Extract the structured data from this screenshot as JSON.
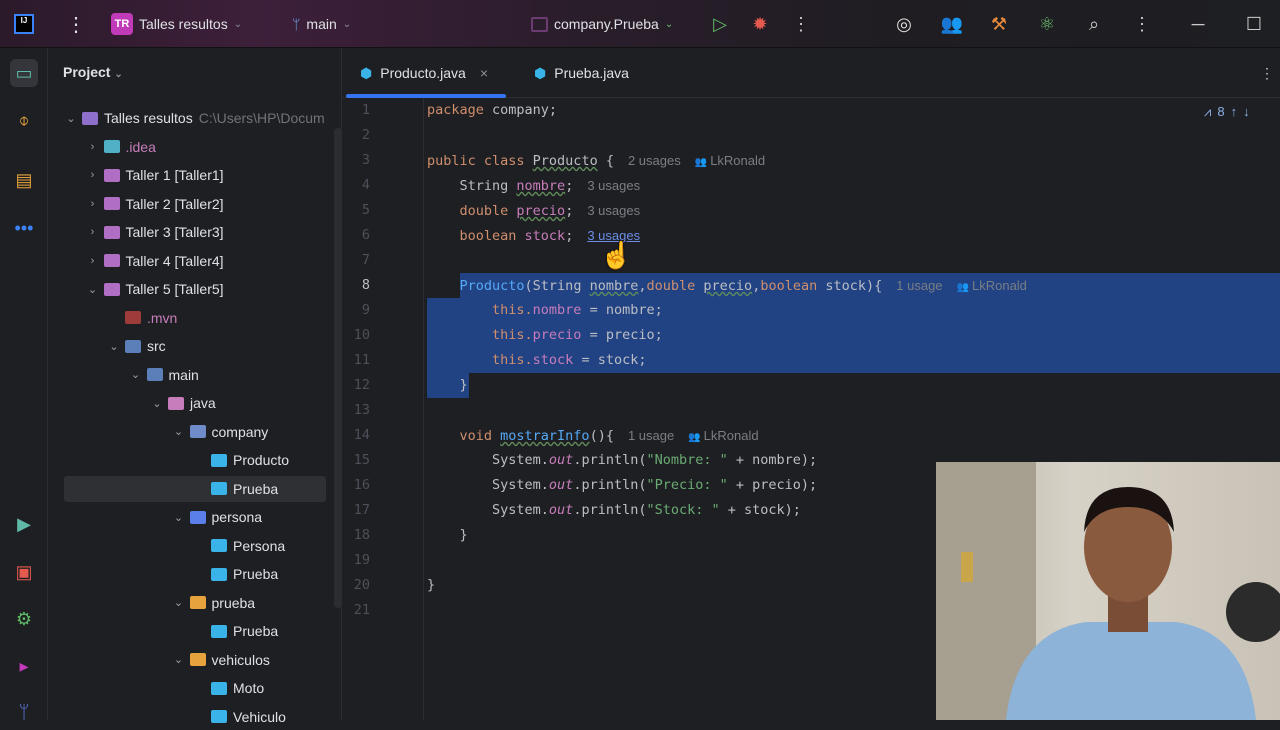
{
  "titlebar": {
    "logo": "IJ",
    "project_badge": "TR",
    "project_name": "Talles resultos",
    "branch": "main",
    "run_config": "company.Prueba"
  },
  "sidebar": {
    "title": "Project"
  },
  "tree": [
    {
      "label": "Talles resultos",
      "extra": "C:\\Users\\HP\\Docum",
      "depth": 0,
      "arrow": "⌄",
      "color": "#8e6fc9"
    },
    {
      "label": ".idea",
      "depth": 1,
      "arrow": "›",
      "color": "#4fb0c6",
      "labelColor": "#c77dbb"
    },
    {
      "label": "Taller 1 [Taller1]",
      "depth": 1,
      "arrow": "›",
      "color": "#b06fc4"
    },
    {
      "label": "Taller 2 [Taller2]",
      "depth": 1,
      "arrow": "›",
      "color": "#b06fc4"
    },
    {
      "label": "Taller 3 [Taller3]",
      "depth": 1,
      "arrow": "›",
      "color": "#b06fc4"
    },
    {
      "label": "Taller 4 [Taller4]",
      "depth": 1,
      "arrow": "›",
      "color": "#b06fc4"
    },
    {
      "label": "Taller 5 [Taller5]",
      "depth": 1,
      "arrow": "⌄",
      "color": "#b06fc4"
    },
    {
      "label": ".mvn",
      "depth": 2,
      "arrow": "",
      "color": "#9e3b3b",
      "labelColor": "#c77dbb"
    },
    {
      "label": "src",
      "depth": 2,
      "arrow": "⌄",
      "color": "#5b7fb8"
    },
    {
      "label": "main",
      "depth": 3,
      "arrow": "⌄",
      "color": "#5b7fb8"
    },
    {
      "label": "java",
      "depth": 4,
      "arrow": "⌄",
      "color": "#c77dbb"
    },
    {
      "label": "company",
      "depth": 5,
      "arrow": "⌄",
      "color": "#6f8bc9"
    },
    {
      "label": "Producto",
      "depth": 6,
      "arrow": "",
      "color": "#3ab4e8"
    },
    {
      "label": "Prueba",
      "depth": 6,
      "arrow": "",
      "color": "#3ab4e8",
      "selected": true
    },
    {
      "label": "persona",
      "depth": 5,
      "arrow": "⌄",
      "color": "#5b7fe8"
    },
    {
      "label": "Persona",
      "depth": 6,
      "arrow": "",
      "color": "#3ab4e8"
    },
    {
      "label": "Prueba",
      "depth": 6,
      "arrow": "",
      "color": "#3ab4e8"
    },
    {
      "label": "prueba",
      "depth": 5,
      "arrow": "⌄",
      "color": "#e6a23c"
    },
    {
      "label": "Prueba",
      "depth": 6,
      "arrow": "",
      "color": "#3ab4e8"
    },
    {
      "label": "vehiculos",
      "depth": 5,
      "arrow": "⌄",
      "color": "#e6a23c"
    },
    {
      "label": "Moto",
      "depth": 6,
      "arrow": "",
      "color": "#3ab4e8"
    },
    {
      "label": "Vehiculo",
      "depth": 6,
      "arrow": "",
      "color": "#3ab4e8"
    }
  ],
  "tabs": [
    {
      "label": "Producto.java",
      "active": true,
      "close": "×"
    },
    {
      "label": "Prueba.java",
      "active": false
    }
  ],
  "inspection": {
    "count": "8"
  },
  "code": [
    {
      "n": "1",
      "t": [
        [
          "package ",
          "kw"
        ],
        [
          "company;",
          "id"
        ]
      ]
    },
    {
      "n": "2",
      "t": []
    },
    {
      "n": "3",
      "t": [
        [
          "public class ",
          "kw"
        ],
        [
          "Producto",
          "cls wavy"
        ],
        [
          " {",
          "id"
        ],
        [
          "2 usages",
          "hint"
        ],
        [
          "LkRonald",
          "hint author"
        ]
      ]
    },
    {
      "n": "4",
      "t": [
        [
          "    String ",
          "id"
        ],
        [
          "nombre",
          "fld wavy"
        ],
        [
          ";",
          "id"
        ],
        [
          "3 usages",
          "hint"
        ]
      ]
    },
    {
      "n": "5",
      "t": [
        [
          "    double ",
          "kw"
        ],
        [
          "precio",
          "fld wavy"
        ],
        [
          ";",
          "id"
        ],
        [
          "3 usages",
          "hint"
        ]
      ]
    },
    {
      "n": "6",
      "t": [
        [
          "    boolean ",
          "kw"
        ],
        [
          "stock",
          "fld"
        ],
        [
          ";",
          "id"
        ],
        [
          "3 usages",
          "hint link"
        ]
      ]
    },
    {
      "n": "7",
      "t": []
    },
    {
      "n": "8",
      "t": [
        [
          "    ",
          ""
        ],
        [
          "Producto",
          "mth"
        ],
        [
          "(String ",
          "id"
        ],
        [
          "nombre",
          "id wavy"
        ],
        [
          ",",
          "id"
        ],
        [
          "double ",
          "kw"
        ],
        [
          "precio",
          "id wavy"
        ],
        [
          ",",
          "id"
        ],
        [
          "boolean ",
          "kw"
        ],
        [
          "stock){",
          "id"
        ],
        [
          "1 usage",
          "hint"
        ],
        [
          "LkRonald",
          "hint author"
        ]
      ],
      "sel": "full"
    },
    {
      "n": "9",
      "t": [
        [
          "        this.",
          "kw"
        ],
        [
          "nombre",
          "fld"
        ],
        [
          " = nombre;",
          "id"
        ]
      ],
      "sel": "full"
    },
    {
      "n": "10",
      "t": [
        [
          "        this.",
          "kw"
        ],
        [
          "precio",
          "fld"
        ],
        [
          " = precio;",
          "id"
        ]
      ],
      "sel": "full"
    },
    {
      "n": "11",
      "t": [
        [
          "        this.",
          "kw"
        ],
        [
          "stock",
          "fld"
        ],
        [
          " = stock;",
          "id"
        ]
      ],
      "sel": "full"
    },
    {
      "n": "12",
      "t": [
        [
          "    }",
          "id"
        ]
      ],
      "sel": "part"
    },
    {
      "n": "13",
      "t": []
    },
    {
      "n": "14",
      "t": [
        [
          "    void ",
          "kw"
        ],
        [
          "mostrarInfo",
          "mth wavy"
        ],
        [
          "(){",
          "id"
        ],
        [
          "1 usage",
          "hint"
        ],
        [
          "LkRonald",
          "hint author"
        ]
      ]
    },
    {
      "n": "15",
      "t": [
        [
          "        System.",
          "id"
        ],
        [
          "out",
          "st"
        ],
        [
          ".println(",
          "id"
        ],
        [
          "\"Nombre: \"",
          "str"
        ],
        [
          " + nombre);",
          "id"
        ]
      ]
    },
    {
      "n": "16",
      "t": [
        [
          "        System.",
          "id"
        ],
        [
          "out",
          "st"
        ],
        [
          ".println(",
          "id"
        ],
        [
          "\"Precio: \"",
          "str"
        ],
        [
          " + precio);",
          "id"
        ]
      ]
    },
    {
      "n": "17",
      "t": [
        [
          "        System.",
          "id"
        ],
        [
          "out",
          "st"
        ],
        [
          ".println(",
          "id"
        ],
        [
          "\"Stock: \"",
          "str"
        ],
        [
          " + stock);",
          "id"
        ]
      ]
    },
    {
      "n": "18",
      "t": [
        [
          "    }",
          "id"
        ]
      ]
    },
    {
      "n": "19",
      "t": []
    },
    {
      "n": "20",
      "t": [
        [
          "}",
          "id"
        ]
      ]
    },
    {
      "n": "21",
      "t": []
    }
  ]
}
